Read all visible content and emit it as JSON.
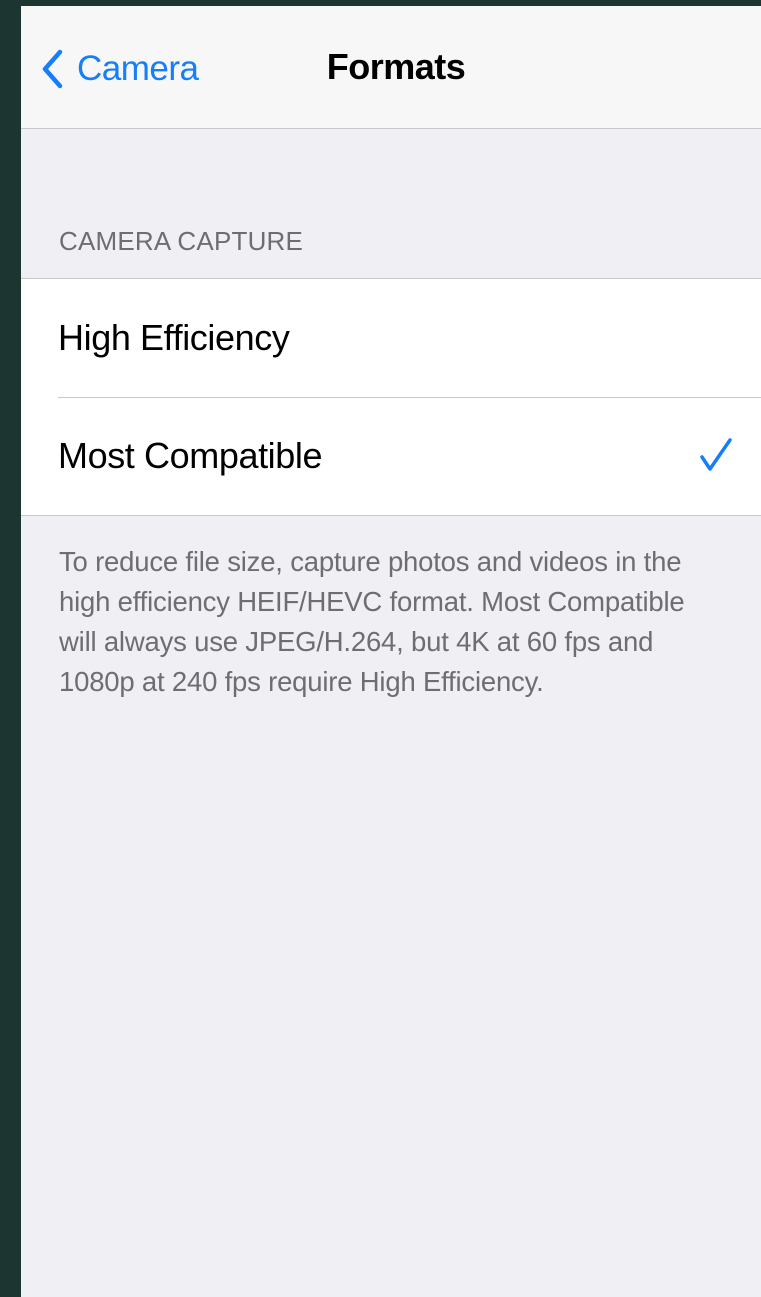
{
  "navbar": {
    "back_label": "Camera",
    "title": "Formats"
  },
  "section": {
    "header": "CAMERA CAPTURE",
    "options": [
      {
        "label": "High Efficiency",
        "selected": false
      },
      {
        "label": "Most Compatible",
        "selected": true
      }
    ],
    "footer": "To reduce file size, capture photos and videos in the high efficiency HEIF/HEVC format. Most Compatible will always use JPEG/H.264, but 4K at 60 fps and 1080p at 240 fps require High Efficiency."
  },
  "colors": {
    "accent": "#157efb",
    "background": "#efeff4",
    "frame": "#1d3530"
  },
  "icons": {
    "back": "chevron-left-icon",
    "selected": "checkmark-icon"
  }
}
